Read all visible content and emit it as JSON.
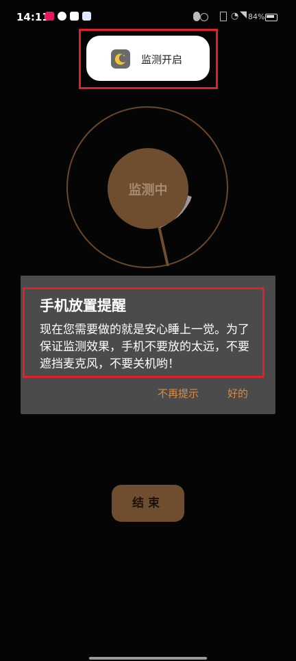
{
  "status_bar": {
    "time": "14:11",
    "battery": "84%"
  },
  "toast": {
    "label": "监测开启",
    "icon": "moon-icon"
  },
  "monitor": {
    "status_label": "监测中"
  },
  "dialog": {
    "title": "手机放置提醒",
    "body": "现在您需要做的就是安心睡上一觉。为了保证监测效果，手机不要放的太远，不要遮挡麦克风，不要关机哟！",
    "dismiss_label": "不再提示",
    "ok_label": "好的"
  },
  "end_button": {
    "label": "结束"
  },
  "colors": {
    "accent_brown": "#6f4e2f",
    "dialog_bg": "#4b4b4b",
    "button_text": "#e08a3a",
    "highlight_red": "#e0202a"
  }
}
